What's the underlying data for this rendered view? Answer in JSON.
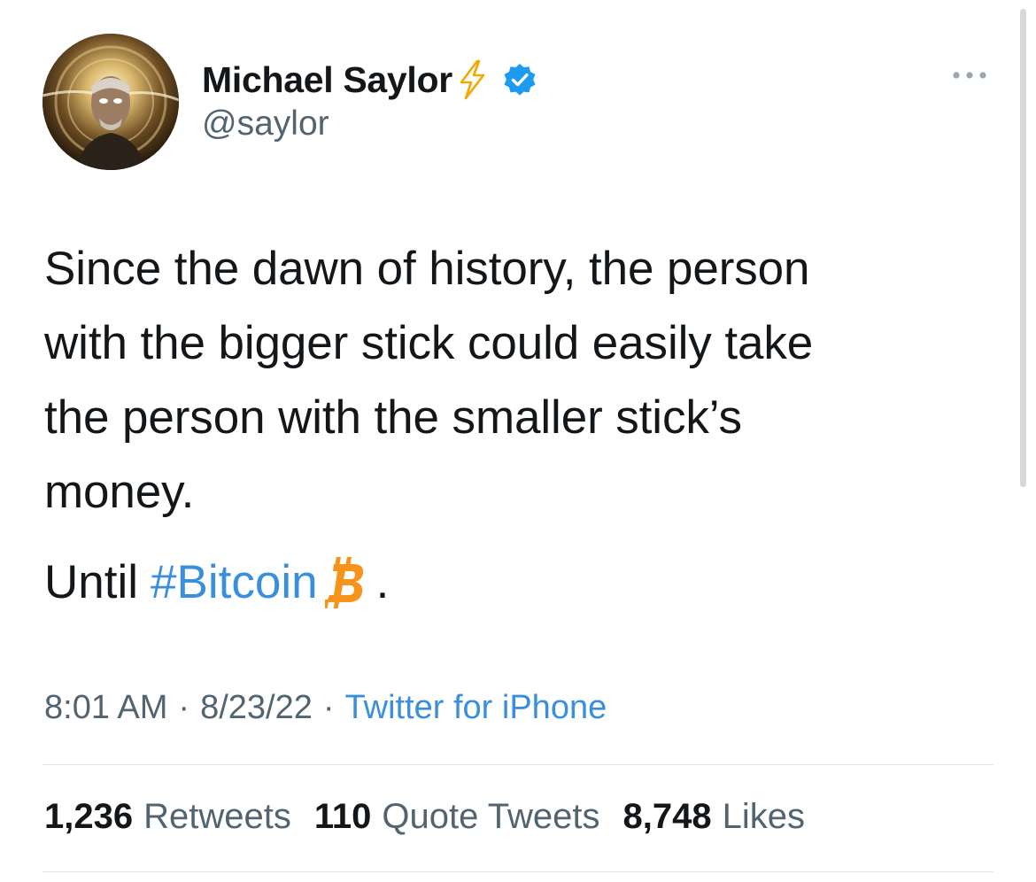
{
  "author": {
    "display_name": "Michael Saylor",
    "handle": "@saylor",
    "avatar_icon": "avatar-photo",
    "badges": [
      "lightning-icon",
      "verified-icon"
    ],
    "verified_color": "#1d9bf0",
    "lightning_color": "#f2a900"
  },
  "more_icon": "more-horizontal-icon",
  "tweet": {
    "lines": [
      "Since the dawn of history, the person",
      "with the bigger stick could easily take",
      "the person with the smaller stick’s",
      "money."
    ],
    "second_paragraph": {
      "prefix": "Until",
      "hashtag": "#Bitcoin",
      "suffix": "."
    },
    "emoji_icon": "bitcoin-icon",
    "emoji_color": "#f7931a"
  },
  "meta": {
    "time": "8:01 AM",
    "separator": "·",
    "date": "8/23/22",
    "source": "Twitter for iPhone"
  },
  "stats": {
    "retweets_count": "1,236",
    "retweets_label": "Retweets",
    "quote_count": "110",
    "quote_label": "Quote Tweets",
    "likes_count": "8,748",
    "likes_label": "Likes"
  },
  "colors": {
    "link": "#3a8ede",
    "secondary_text": "#536471",
    "primary_text": "#14171a"
  }
}
